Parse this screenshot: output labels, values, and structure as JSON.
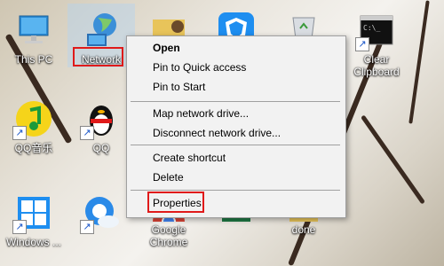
{
  "desktop": {
    "icons": [
      {
        "label": "This PC",
        "icon": "computer-icon"
      },
      {
        "label": "Network",
        "icon": "globe-network-icon"
      },
      {
        "label": "",
        "icon": "user-folder-icon"
      },
      {
        "label": "",
        "icon": "shield-app-icon"
      },
      {
        "label": "",
        "icon": "recycle-bin-icon"
      },
      {
        "label": "Clear Clipboard",
        "icon": "terminal-icon"
      },
      {
        "label": "QQ音乐",
        "icon": "qq-music-icon"
      },
      {
        "label": "QQ",
        "icon": "qq-penguin-icon"
      },
      {
        "label": "Windows ...",
        "icon": "windows-logo-icon"
      },
      {
        "label": "",
        "icon": "cloud-app-icon"
      },
      {
        "label": "Google Chrome",
        "icon": "chrome-icon"
      },
      {
        "label": "",
        "icon": "spreadsheet-icon"
      },
      {
        "label": "done",
        "icon": "folder-icon"
      }
    ]
  },
  "context_menu": {
    "items": [
      {
        "label": "Open",
        "bold": true
      },
      {
        "label": "Pin to Quick access"
      },
      {
        "label": "Pin to Start"
      },
      {
        "label": "Map network drive..."
      },
      {
        "label": "Disconnect network drive..."
      },
      {
        "label": "Create shortcut"
      },
      {
        "label": "Delete"
      },
      {
        "label": "Properties"
      }
    ]
  },
  "colors": {
    "highlight_box": "#e01a1a",
    "menu_background": "#f2f2f2"
  }
}
